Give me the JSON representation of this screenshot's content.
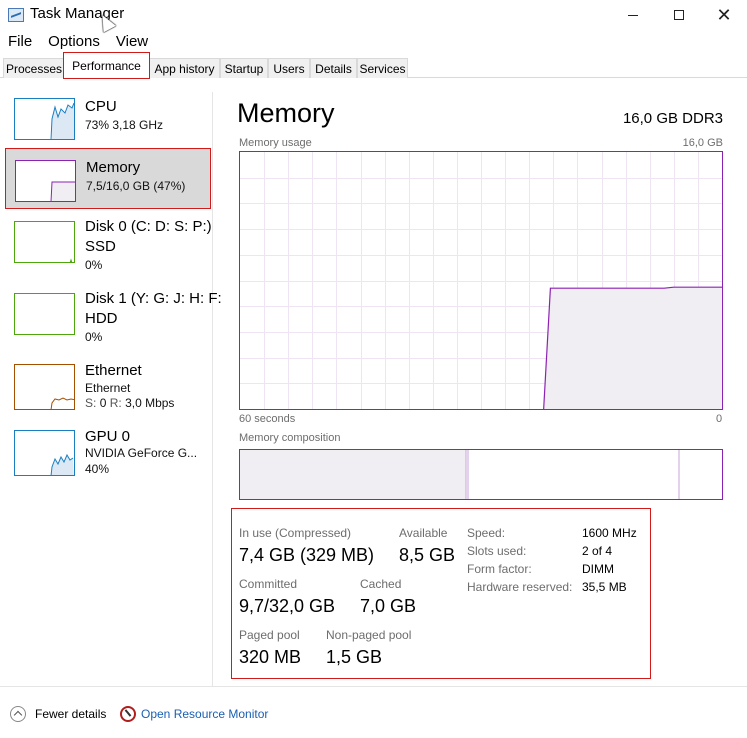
{
  "window": {
    "title": "Task Manager",
    "controls": {
      "minimize": "minimize",
      "maximize": "maximize",
      "close": "close"
    }
  },
  "menu": [
    "File",
    "Options",
    "View"
  ],
  "tabs": [
    "Processes",
    "Performance",
    "App history",
    "Startup",
    "Users",
    "Details",
    "Services"
  ],
  "active_tab": "Performance",
  "sidebar": [
    {
      "title": "CPU",
      "sub1": "73%  3,18 GHz",
      "color": "#1a7fc1"
    },
    {
      "title": "Memory",
      "sub1": "7,5/16,0 GB (47%)",
      "color": "#8b22b3"
    },
    {
      "title": "Disk 0 (C: D: S: P:)",
      "title2": "SSD",
      "sub1": "0%",
      "color": "#4da60c"
    },
    {
      "title": "Disk 1 (Y: G: J: H: F:",
      "title2": "HDD",
      "sub1": "0%",
      "color": "#4da60c"
    },
    {
      "title": "Ethernet",
      "sub1": "Ethernet",
      "sub2_s": "S:",
      "sub2_sv": "0",
      "sub2_r": "R:",
      "sub2_rv": "3,0 Mbps",
      "color": "#a74f01"
    },
    {
      "title": "GPU 0",
      "sub1": "NVIDIA GeForce G...",
      "sub2": "40%",
      "color": "#1a7fc1"
    }
  ],
  "main": {
    "title": "Memory",
    "spec": "16,0 GB DDR3",
    "usage_label": "Memory usage",
    "usage_max": "16,0 GB",
    "time_left": "60 seconds",
    "time_right": "0",
    "composition_label": "Memory composition",
    "usage_level": 0.47,
    "accent": "#8b22b3",
    "fill": "#f1eef3"
  },
  "stats": {
    "in_use_label": "In use (Compressed)",
    "in_use_value": "7,4 GB (329 MB)",
    "available_label": "Available",
    "available_value": "8,5 GB",
    "committed_label": "Committed",
    "committed_value": "9,7/32,0 GB",
    "cached_label": "Cached",
    "cached_value": "7,0 GB",
    "paged_label": "Paged pool",
    "paged_value": "320 MB",
    "nonpaged_label": "Non-paged pool",
    "nonpaged_value": "1,5 GB",
    "speed_label": "Speed:",
    "speed_value": "1600 MHz",
    "slots_label": "Slots used:",
    "slots_value": "2 of 4",
    "form_label": "Form factor:",
    "form_value": "DIMM",
    "hw_label": "Hardware reserved:",
    "hw_value": "35,5 MB"
  },
  "footer": {
    "fewer_details": "Fewer details",
    "open_monitor": "Open Resource Monitor"
  }
}
